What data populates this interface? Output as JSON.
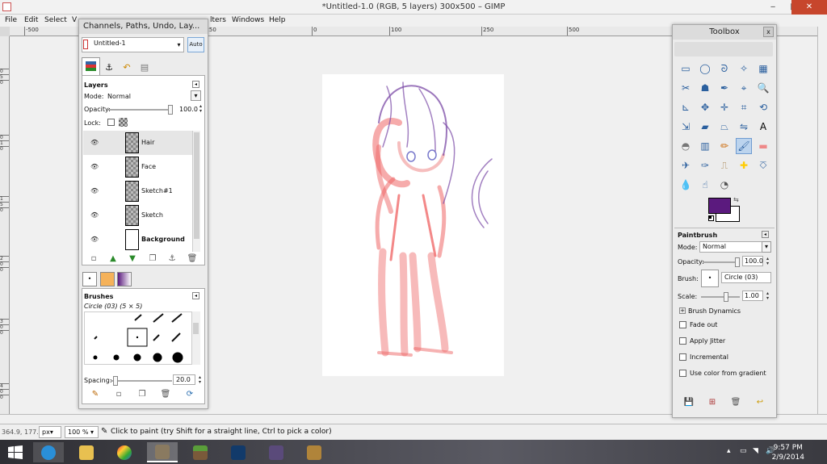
{
  "window": {
    "title": "*Untitled-1.0 (RGB, 5 layers) 300x500 – GIMP",
    "minimize": "‒",
    "maximize": "□",
    "close": "✕"
  },
  "menu": [
    "File",
    "Edit",
    "Select",
    "V",
    "lters",
    "Windows",
    "Help"
  ],
  "ruler": {
    "top": [
      "-500",
      "1250",
      "0",
      "100",
      "250",
      "500"
    ],
    "left": [
      "0",
      "5",
      "0",
      "0",
      "1",
      "0",
      "0",
      "1",
      "5",
      "0",
      "2",
      "0",
      "0",
      "2",
      "5",
      "0",
      "3",
      "0",
      "0",
      "3",
      "5",
      "0",
      "4",
      "0",
      "0",
      "4",
      "5",
      "0"
    ]
  },
  "layers_dock": {
    "title": "Channels, Paths, Undo, Lay...",
    "image_select": "Untitled-1",
    "auto_label": "Auto",
    "layers": {
      "header": "Layers",
      "mode_label": "Mode:",
      "mode_value": "Normal",
      "opacity_label": "Opacity:",
      "opacity_value": "100.0",
      "opacity_fraction": 1.0,
      "lock_label": "Lock:",
      "items": [
        {
          "name": "Hair",
          "bold": false
        },
        {
          "name": "Face",
          "bold": false
        },
        {
          "name": "Sketch#1",
          "bold": false
        },
        {
          "name": "Sketch",
          "bold": false
        },
        {
          "name": "Background",
          "bold": true
        }
      ]
    },
    "brushes": {
      "header": "Brushes",
      "selected": "Circle (03) (5 × 5)",
      "spacing_label": "Spacing:",
      "spacing_value": "20.0"
    }
  },
  "toolbox": {
    "title": "Toolbox",
    "fg_color": "#5b1a7e",
    "bg_color": "#ffffff",
    "tools": [
      "rect-select-icon",
      "ellipse-select-icon",
      "free-select-icon",
      "fuzzy-select-icon",
      "color-select-icon",
      "scissors-icon",
      "foreground-select-icon",
      "paths-icon",
      "color-picker-icon",
      "zoom-icon",
      "measure-icon",
      "move-icon",
      "align-icon",
      "crop-icon",
      "rotate-icon",
      "scale-icon",
      "shear-icon",
      "perspective-icon",
      "flip-icon",
      "text-icon",
      "bucket-fill-icon",
      "blend-icon",
      "pencil-icon",
      "paintbrush-icon",
      "eraser-icon",
      "airbrush-icon",
      "ink-icon",
      "clone-icon",
      "heal-icon",
      "perspective-clone-icon",
      "blur-icon",
      "smudge-icon",
      "dodge-burn-icon"
    ],
    "options": {
      "header": "Paintbrush",
      "mode_label": "Mode:",
      "mode_value": "Normal",
      "opacity_label": "Opacity:",
      "opacity_value": "100.0",
      "opacity_fraction": 1.0,
      "brush_label": "Brush:",
      "brush_value": "Circle (03)",
      "scale_label": "Scale:",
      "scale_value": "1.00",
      "brush_dynamics": "Brush Dynamics",
      "fade_out": "Fade out",
      "apply_jitter": "Apply Jitter",
      "incremental": "Incremental",
      "use_gradient": "Use color from gradient"
    }
  },
  "statusbar": {
    "coords": "364.9, 177.7",
    "unit": "px",
    "zoom": "100 %",
    "message": "Click to paint (try Shift for a straight line, Ctrl to pick a color)"
  },
  "taskbar": {
    "time": "9:57 PM",
    "date": "2/9/2014"
  }
}
